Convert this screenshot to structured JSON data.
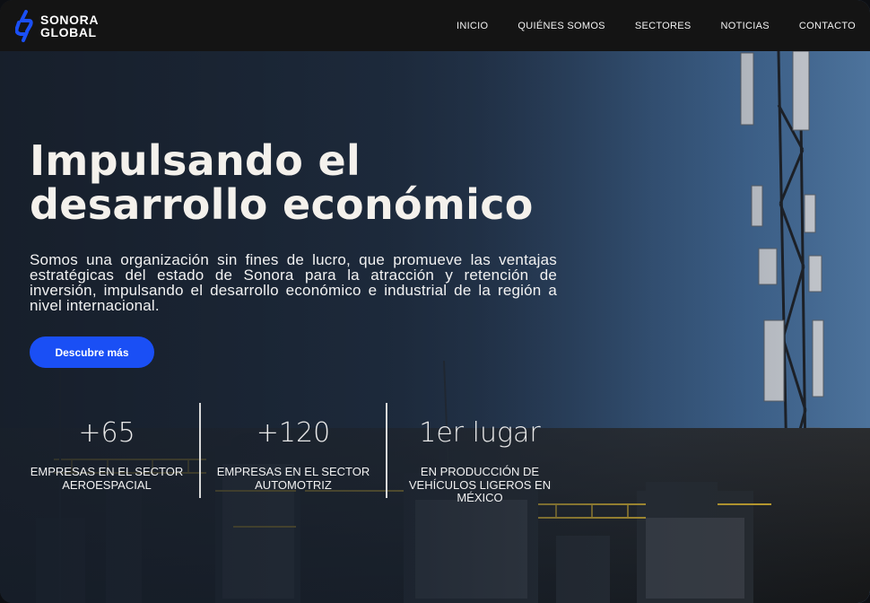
{
  "brand": {
    "name_line1": "SONORA",
    "name_line2": "GLOBAL",
    "accent": "#1a4ff5"
  },
  "nav": {
    "items": [
      {
        "label": "INICIO"
      },
      {
        "label": "QUIÉNES SOMOS"
      },
      {
        "label": "SECTORES"
      },
      {
        "label": "NOTICIAS"
      },
      {
        "label": "CONTACTO"
      }
    ]
  },
  "hero": {
    "title": "Impulsando el desarrollo económico",
    "description": "Somos una organización sin fines de lucro, que promueve las ventajas estratégicas del estado de Sonora para la atracción y retención de inversión, impulsando el desarrollo económico e industrial de la región a nivel internacional.",
    "cta_label": "Descubre más"
  },
  "stats": [
    {
      "value": "+65",
      "label": "EMPRESAS EN EL SECTOR AEROESPACIAL"
    },
    {
      "value": "+120",
      "label": "EMPRESAS EN EL SECTOR AUTOMOTRIZ"
    },
    {
      "value": "1er lugar",
      "label": "EN PRODUCCIÓN DE VEHÍCULOS LIGEROS EN MÉXICO"
    }
  ],
  "icons": {
    "logo": "sonora-global-logo-mark"
  }
}
